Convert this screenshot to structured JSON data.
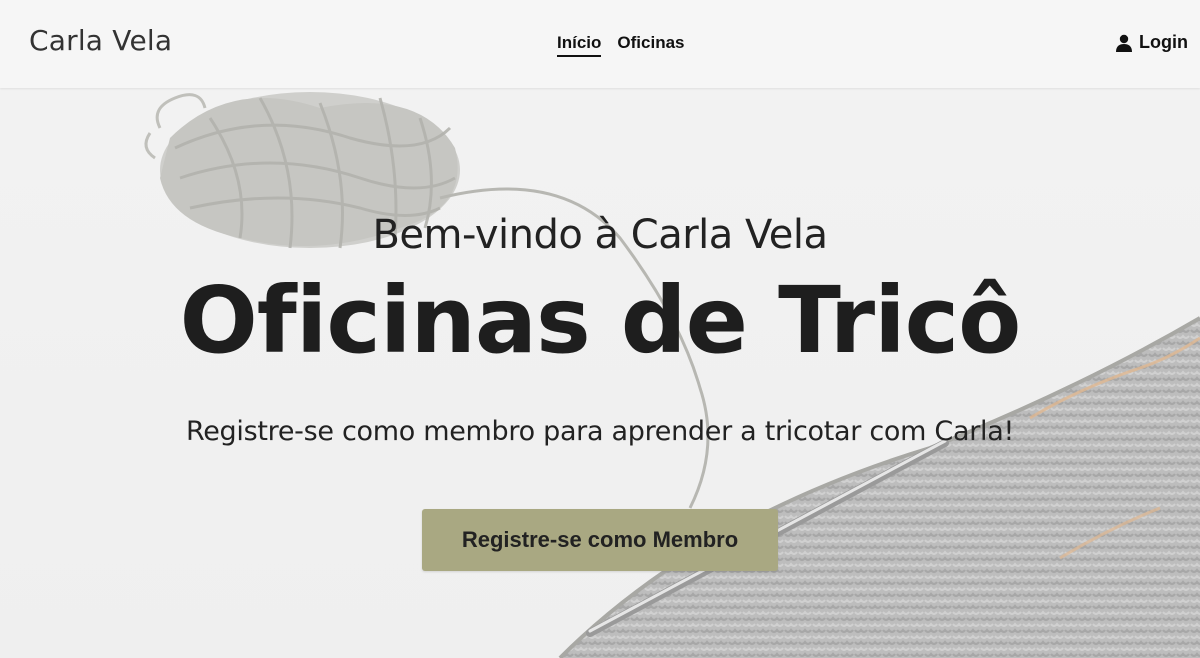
{
  "brand": "Carla Vela",
  "nav": {
    "items": [
      {
        "label": "Início",
        "active": true
      },
      {
        "label": "Oficinas",
        "active": false
      }
    ]
  },
  "login": {
    "label": "Login",
    "icon": "user-icon"
  },
  "hero": {
    "subtitle": "Bem-vindo à Carla Vela",
    "title": "Oficinas de Tricô",
    "text": "Registre-se como membro para aprender a tricotar com Carla!",
    "cta_label": "Registre-se como Membro"
  },
  "colors": {
    "cta_background": "#a9a882",
    "navbar_background": "#f6f6f6"
  }
}
